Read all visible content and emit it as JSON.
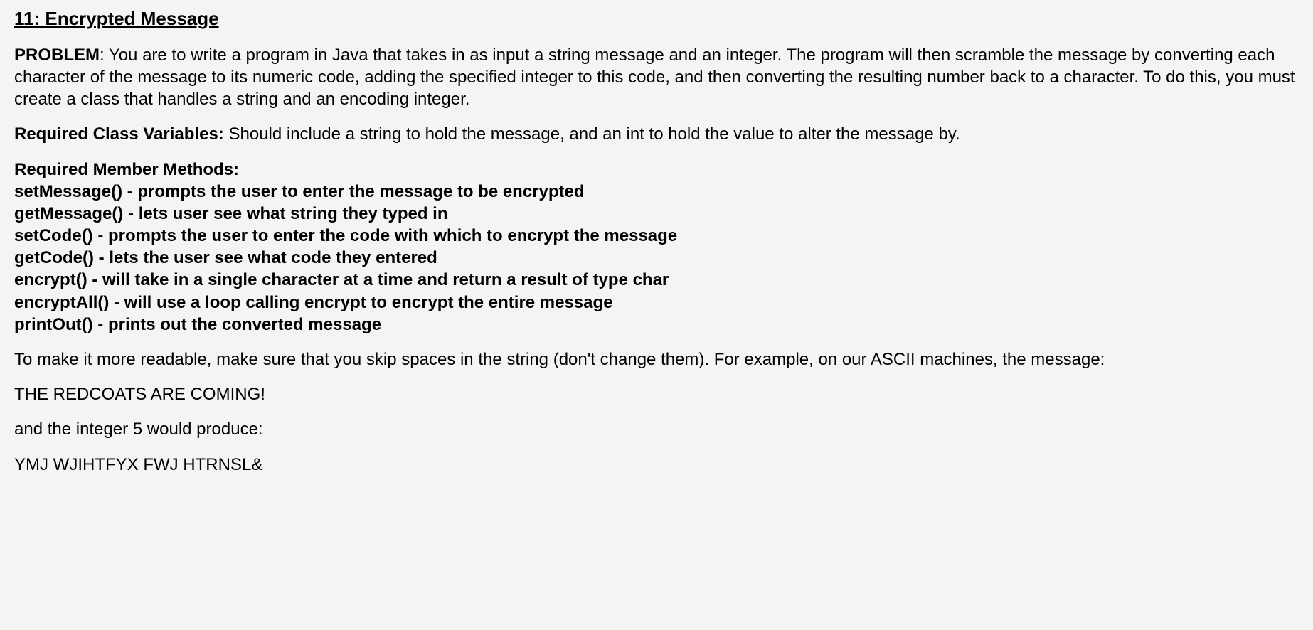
{
  "title": "11: Encrypted Message",
  "problem": {
    "label": "PROBLEM",
    "text": ": You are to write a program in Java that takes in as input a string message and an integer.  The program will then scramble the message by converting each character of the message to its numeric code, adding the specified integer to this code, and then converting the resulting number back to a character.  To do this, you must create a class that handles a string and an encoding integer."
  },
  "classVars": {
    "label": "Required Class Variables:",
    "text": " Should include a string to hold the message, and an int to hold the value to alter the message by."
  },
  "methodsHeading": "Required Member Methods:",
  "methods": [
    "setMessage() - prompts the user to enter the message to be encrypted",
    "getMessage() - lets user see what string they typed in",
    "setCode() - prompts the user to enter the code with which to encrypt the message",
    "getCode() - lets the user see what code they entered",
    "encrypt() - will take in a single character at a time and return a result of type char",
    "encryptAll() - will use a loop calling encrypt to encrypt the entire message",
    "printOut() - prints out the converted message"
  ],
  "readable": "To make it more readable, make sure that you skip spaces in the string (don't change them).  For example, on our ASCII machines, the message:",
  "exampleInput": "THE REDCOATS ARE COMING!",
  "andInteger": "and the integer 5 would produce:",
  "exampleOutput": "YMJ  WJIHTFYX  FWJ  HTRNSL&"
}
